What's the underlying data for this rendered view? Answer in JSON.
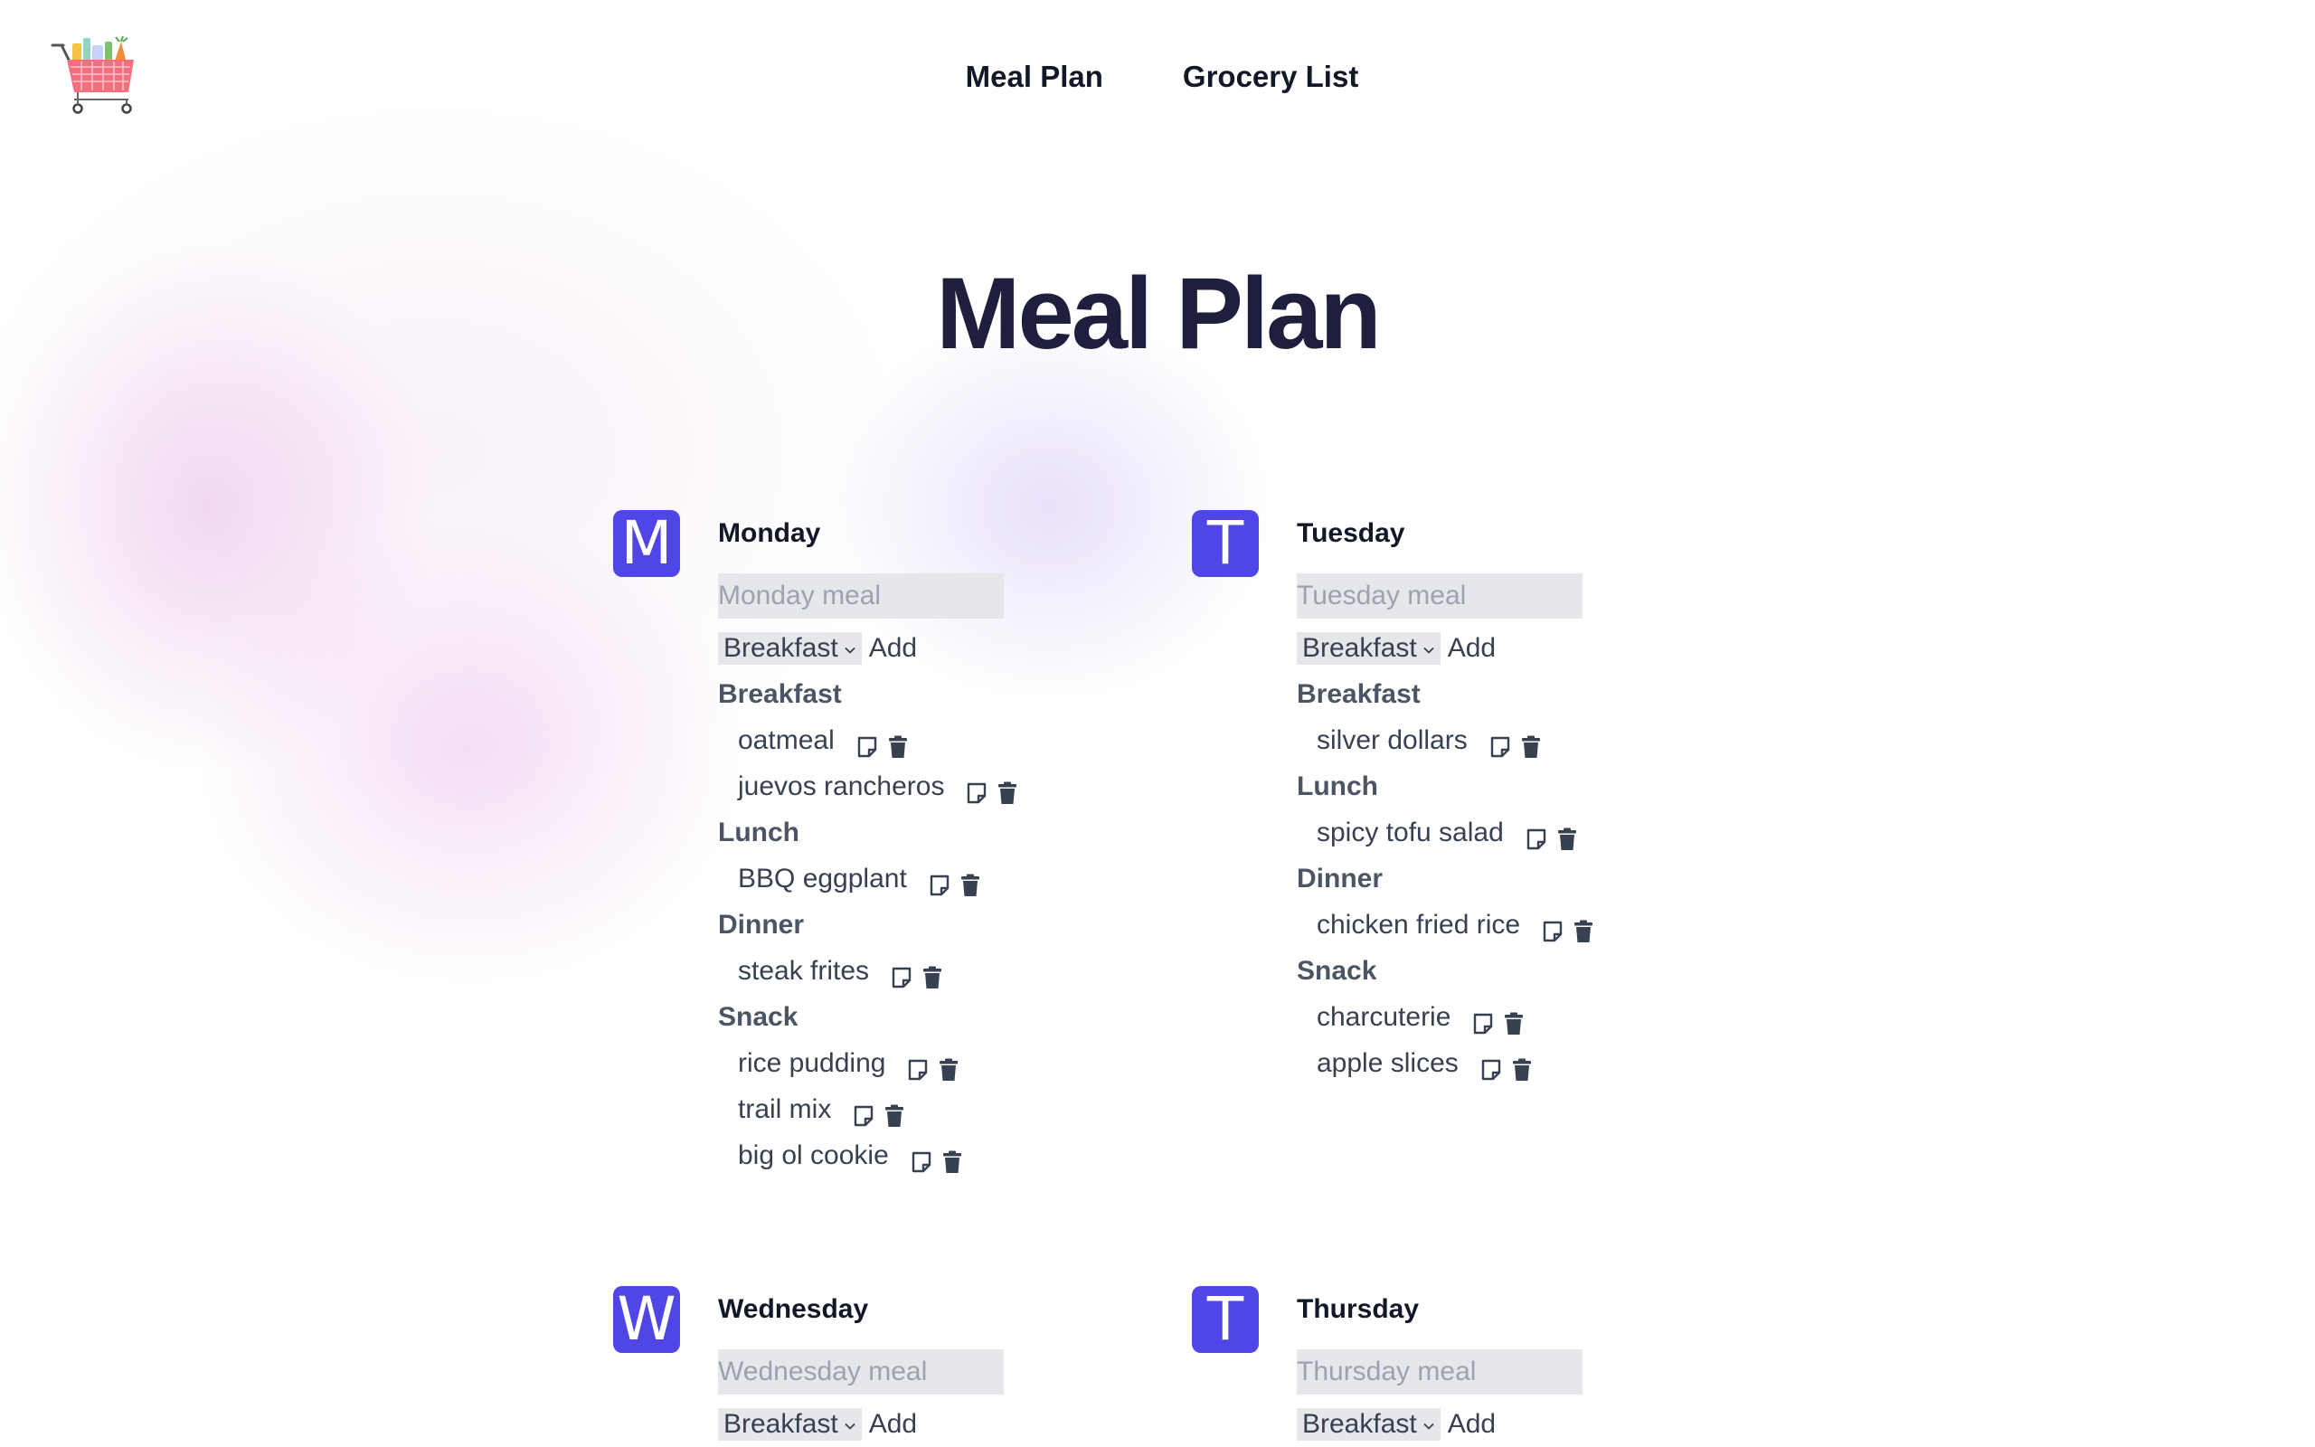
{
  "nav": {
    "items": [
      "Meal Plan",
      "Grocery List"
    ]
  },
  "page": {
    "title": "Meal Plan"
  },
  "colors": {
    "accent": "#4f46e5",
    "title": "#1e1f3d",
    "input_bg": "#e5e7eb"
  },
  "icons": {
    "logo": "shopping-cart-groceries",
    "note": "note-icon",
    "delete": "trash-icon"
  },
  "days": [
    {
      "initial": "M",
      "name": "Monday",
      "placeholder": "Monday meal",
      "select_value": "Breakfast",
      "add_label": "Add",
      "sections": [
        {
          "title": "Breakfast",
          "items": [
            "oatmeal",
            "juevos rancheros"
          ]
        },
        {
          "title": "Lunch",
          "items": [
            "BBQ eggplant"
          ]
        },
        {
          "title": "Dinner",
          "items": [
            "steak frites"
          ]
        },
        {
          "title": "Snack",
          "items": [
            "rice pudding",
            "trail mix",
            "big ol cookie"
          ]
        }
      ]
    },
    {
      "initial": "T",
      "name": "Tuesday",
      "placeholder": "Tuesday meal",
      "select_value": "Breakfast",
      "add_label": "Add",
      "sections": [
        {
          "title": "Breakfast",
          "items": [
            "silver dollars"
          ]
        },
        {
          "title": "Lunch",
          "items": [
            "spicy tofu salad"
          ]
        },
        {
          "title": "Dinner",
          "items": [
            "chicken fried rice"
          ]
        },
        {
          "title": "Snack",
          "items": [
            "charcuterie",
            "apple slices"
          ]
        }
      ]
    },
    {
      "initial": "W",
      "name": "Wednesday",
      "placeholder": "Wednesday meal",
      "select_value": "Breakfast",
      "add_label": "Add",
      "sections": []
    },
    {
      "initial": "T",
      "name": "Thursday",
      "placeholder": "Thursday meal",
      "select_value": "Breakfast",
      "add_label": "Add",
      "sections": []
    }
  ]
}
